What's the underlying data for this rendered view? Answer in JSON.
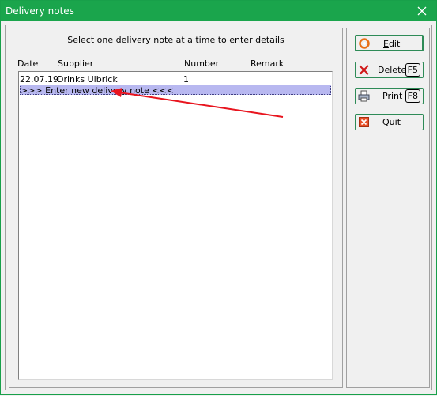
{
  "window": {
    "title": "Delivery notes",
    "close_icon": "close-icon"
  },
  "left": {
    "hint": "Select one delivery note at a time to enter details",
    "columns": {
      "date": "Date",
      "supplier": "Supplier",
      "number": "Number",
      "remark": "Remark"
    },
    "rows": [
      {
        "date": "22.07.19",
        "supplier": "Drinks Ulbrick",
        "number": "1",
        "remark": ""
      }
    ],
    "new_entry": ">>> Enter new delivery note <<<"
  },
  "buttons": {
    "edit": {
      "first": "E",
      "rest": "dit"
    },
    "delete": {
      "first": "D",
      "rest": "elete",
      "key": "F5"
    },
    "print": {
      "first": "P",
      "rest": "rint",
      "key": "F8"
    },
    "quit": {
      "first": "Q",
      "rest": "uit"
    }
  },
  "colors": {
    "titlebar": "#1aa54c",
    "selection": "#b8b8f0",
    "arrow": "#e8141e"
  }
}
